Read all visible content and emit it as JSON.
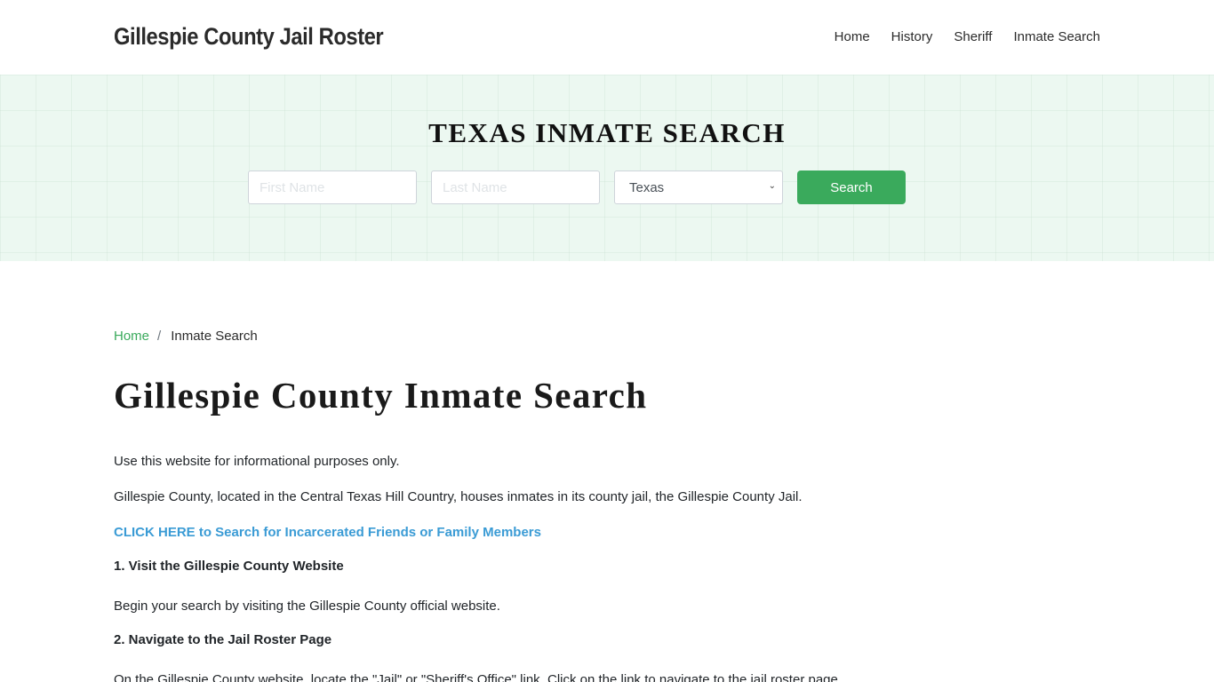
{
  "header": {
    "brand": "Gillespie County Jail Roster",
    "nav": [
      {
        "label": "Home"
      },
      {
        "label": "History"
      },
      {
        "label": "Sheriff"
      },
      {
        "label": "Inmate Search"
      }
    ]
  },
  "hero": {
    "title": "TEXAS INMATE SEARCH",
    "first_name_placeholder": "First Name",
    "first_name_value": "",
    "last_name_placeholder": "Last Name",
    "last_name_value": "",
    "state_selected": "Texas",
    "search_label": "Search",
    "icons": {
      "select_chevron": "chevron-down-icon"
    }
  },
  "breadcrumb": {
    "home": "Home",
    "separator": "/",
    "current": "Inmate Search"
  },
  "main": {
    "title": "Gillespie County Inmate Search",
    "intro": "Use this website for informational purposes only.",
    "description": "Gillespie County, located in the Central Texas Hill Country, houses inmates in its county jail, the Gillespie County Jail.",
    "cta_link": "CLICK HERE to Search for Incarcerated Friends or Family Members",
    "steps": [
      {
        "heading": "1. Visit the Gillespie County Website",
        "text": "Begin your search by visiting the Gillespie County official website."
      },
      {
        "heading": "2. Navigate to the Jail Roster Page",
        "text": "On the Gillespie County website, locate the \"Jail\" or \"Sheriff's Office\" link. Click on the link to navigate to the jail roster page."
      }
    ]
  },
  "colors": {
    "accent_green": "#3aaa5c",
    "link_blue": "#3a9bd5",
    "hero_bg": "#ecf8f1"
  }
}
